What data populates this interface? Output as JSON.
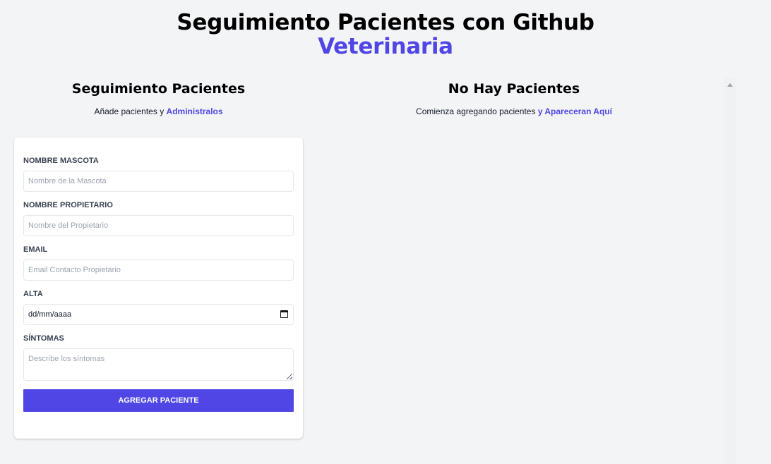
{
  "header": {
    "title": "Seguimiento Pacientes con Github",
    "accent": "Veterinaria"
  },
  "form_section": {
    "title": "Seguimiento Pacientes",
    "subtitle_prefix": "Añade pacientes y ",
    "subtitle_highlight": "Administralos"
  },
  "list_section": {
    "title": "No Hay Pacientes",
    "subtitle_prefix": "Comienza agregando pacientes ",
    "subtitle_highlight": "y Apareceran Aquí"
  },
  "form": {
    "pet_name": {
      "label": "Nombre Mascota",
      "placeholder": "Nombre de la Mascota",
      "value": ""
    },
    "owner_name": {
      "label": "Nombre Propietario",
      "placeholder": "Nombre del Propietario",
      "value": ""
    },
    "email": {
      "label": "Email",
      "placeholder": "Email Contacto Propietario",
      "value": ""
    },
    "discharge": {
      "label": "Alta",
      "value": "dd/mm/aaaa"
    },
    "symptoms": {
      "label": "Síntomas",
      "placeholder": "Describe los síntomas",
      "value": ""
    },
    "submit_label": "Agregar Paciente"
  },
  "colors": {
    "accent": "#4f46e5",
    "background": "#f3f4f6",
    "card": "#ffffff"
  },
  "icons": {
    "date_picker": "calendar-icon",
    "scroll_up": "scroll-up-arrow-icon"
  }
}
